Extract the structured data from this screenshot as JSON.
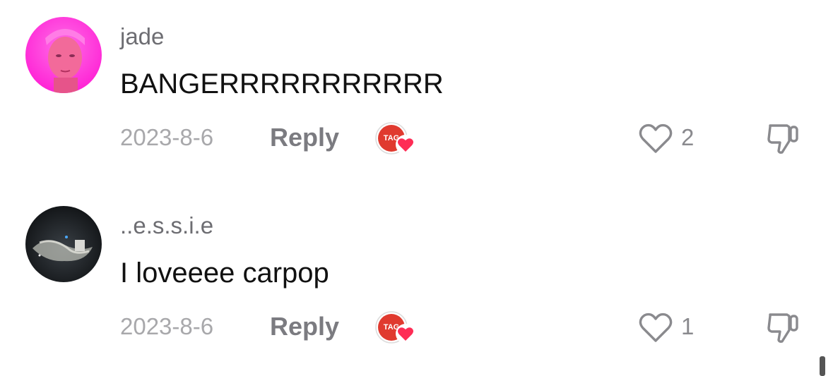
{
  "comments": [
    {
      "username": "jade",
      "text": "BANGERRRRRRRRRRR",
      "date": "2023-8-6",
      "reply_label": "Reply",
      "like_count": "2",
      "creator_badge_text": "TAG",
      "avatar_color": "#ff2fd8",
      "icons": {
        "like": "heart-outline-icon",
        "dislike": "thumbs-down-outline-icon",
        "creator_like": "creator-liked-heart-icon"
      }
    },
    {
      "username": "..e.s.s.i.e",
      "text": "I loveeee carpop",
      "date": "2023-8-6",
      "reply_label": "Reply",
      "like_count": "1",
      "creator_badge_text": "TAG",
      "avatar_color": "#1b1f24",
      "icons": {
        "like": "heart-outline-icon",
        "dislike": "thumbs-down-outline-icon",
        "creator_like": "creator-liked-heart-icon"
      }
    }
  ],
  "colors": {
    "username": "#6d6d72",
    "comment_text": "#111111",
    "meta": "#a8a8ab",
    "reply": "#7b7b80",
    "heart_badge": "#fe2c55",
    "creator_badge": "#e03a2f"
  }
}
